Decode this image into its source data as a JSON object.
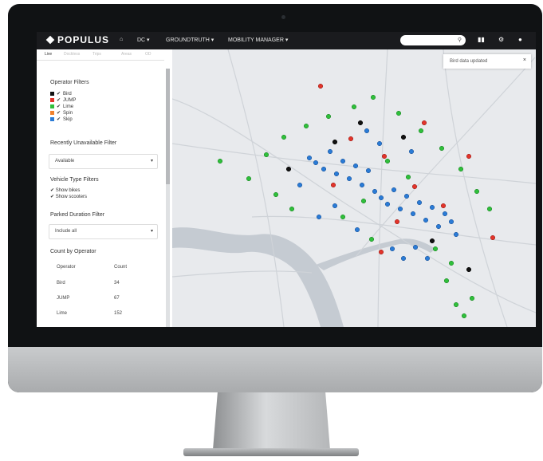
{
  "app": {
    "brand": "POPULUS",
    "nav": {
      "city": "DC ▾",
      "groundtruth": "GROUNDTRUTH ▾",
      "mobility_manager": "MOBILITY MANAGER ▾"
    },
    "search": {
      "placeholder": ""
    },
    "icons": [
      "home-icon",
      "search-icon",
      "map-icon",
      "settings-icon",
      "user-icon"
    ]
  },
  "sidebar": {
    "tabs": [
      "Live",
      "Dockless",
      "Trips",
      "Areas",
      "OD"
    ],
    "operator_filters_title": "Operator Filters",
    "operators": [
      {
        "label": "Bird",
        "color": "#111111"
      },
      {
        "label": "JUMP",
        "color": "#e2342b"
      },
      {
        "label": "Lime",
        "color": "#2fbf3b"
      },
      {
        "label": "Spin",
        "color": "#f0812d"
      },
      {
        "label": "Skip",
        "color": "#2a7bd6"
      }
    ],
    "recently_unavailable_title": "Recently Unavailable Filter",
    "recently_unavailable_value": "Available",
    "vehicle_type_title": "Vehicle Type Filters",
    "vehicle_types": [
      "Show bikes",
      "Show scooters"
    ],
    "parked_duration_title": "Parked Duration Filter",
    "parked_duration_value": "Include all",
    "count_title": "Count by Operator",
    "count_headers": [
      "Operator",
      "Count"
    ],
    "count_rows": [
      {
        "operator": "Bird",
        "count": "34"
      },
      {
        "operator": "JUMP",
        "count": "67"
      },
      {
        "operator": "Lime",
        "count": "152"
      }
    ]
  },
  "toast": {
    "text": "Bird data updated",
    "close": "×"
  },
  "colors": {
    "bird": "#111111",
    "jump": "#e2342b",
    "lime": "#2fbf3b",
    "skip": "#2a7bd6",
    "map_bg": "#e8eaed",
    "water": "#c5cbd2"
  }
}
